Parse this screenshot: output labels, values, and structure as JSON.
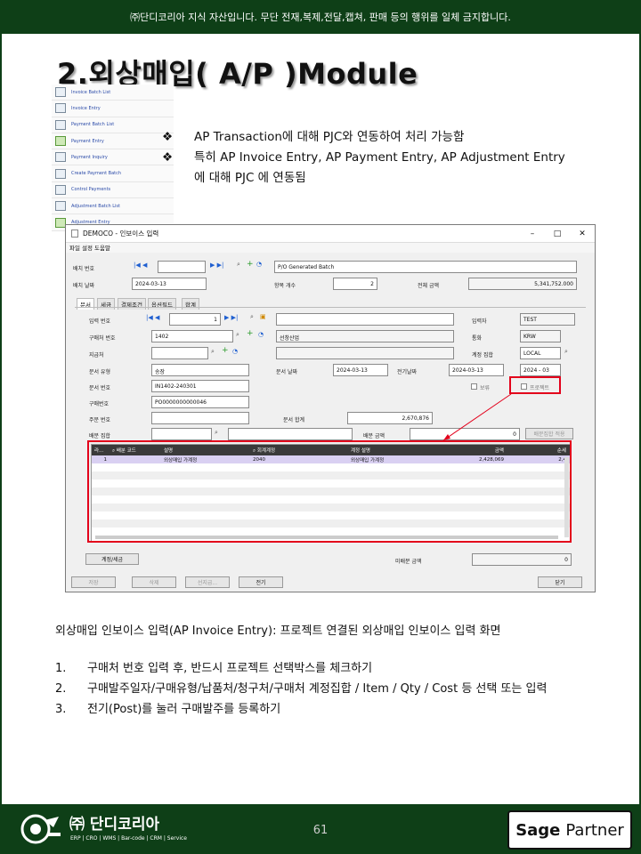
{
  "banner": "㈜단디코리아 지식 자산입니다. 무단 전재,복제,전달,캡쳐, 판매 등의 행위를 일체 금지합니다.",
  "title": "2.외상매입( A/P )Module",
  "side_menu": [
    {
      "label": "Invoice Batch List",
      "icon": "list-icon"
    },
    {
      "label": "Invoice Entry",
      "icon": "document-icon"
    },
    {
      "label": "Payment Batch List",
      "icon": "list-icon"
    },
    {
      "label": "Payment Entry",
      "icon": "payment-icon"
    },
    {
      "label": "Payment Inquiry",
      "icon": "magnifier-icon"
    },
    {
      "label": "Create Payment Batch",
      "icon": "batch-icon"
    },
    {
      "label": "Control Payments",
      "icon": "grid-icon"
    },
    {
      "label": "Adjustment Batch List",
      "icon": "list-icon"
    },
    {
      "label": "Adjustment Entry",
      "icon": "adjust-icon"
    }
  ],
  "bullets": {
    "marker": "❖",
    "line1": "AP Transaction에 대해 PJC와 연동하여 처리 가능함",
    "line2": "특히 AP Invoice Entry,  AP Payment Entry, AP Adjustment Entry",
    "line3": "에 대해 PJC 에 연동됨"
  },
  "window": {
    "title": "DEMOCO - 인보이스 입력",
    "menu": "파일  설정  도움말",
    "batch_no_label": "배치 번호",
    "batch_no": "",
    "batch_desc": "P/O Generated Batch",
    "batch_date_label": "배치 날짜",
    "batch_date": "2024-03-13",
    "entry_count_label": "항목 개수",
    "entry_count": "2",
    "total_label": "전체 금액",
    "total": "5,341,752.000",
    "tabs": [
      "문서",
      "세금",
      "결제조건",
      "옵션필드",
      "합계"
    ],
    "entry_no_label": "입력 번호",
    "entry_no": "1",
    "entered_by_label": "입력자",
    "entered_by": "TEST",
    "vendor_no_label": "구매처 번호",
    "vendor_no": "1402",
    "vendor_name": "선창산업",
    "currency_label": "통화",
    "currency": "KRW",
    "remit_label": "지급처",
    "account_set_label": "계정 집합",
    "account_set": "LOCAL",
    "doc_type_label": "문서 유형",
    "doc_type": "송장",
    "doc_date_label": "문서 날짜",
    "doc_date": "2024-03-13",
    "posting_date_label": "전기날짜",
    "posting_date": "2024-03-13",
    "period": "2024 - 03",
    "doc_no_label": "문서 번호",
    "doc_no": "IN1402-240301",
    "hold_label": "보류",
    "project_label": "프로젝트",
    "po_no_label": "구매번호",
    "po_no": "PO0000000000046",
    "order_no_label": "주문 번호",
    "doc_total_label": "문서 합계",
    "doc_total": "2,670,876",
    "dist_set_label": "배분 집합",
    "dist_amount_label": "배분 금액",
    "dist_amount": "0",
    "dist_apply_btn": "배분집합 적용",
    "grid_headers": [
      "라...",
      "배분 코드",
      "설명",
      "회계계정",
      "계정 설명",
      "금액",
      "순세"
    ],
    "grid_rows": [
      [
        "1",
        "",
        "외상매입 가계정",
        "2040",
        "외상매입 가계정",
        "2,428,069",
        "2,4"
      ]
    ],
    "account_tax_btn": "계정/세금",
    "undist_label": "미배분 금액",
    "undist": "0",
    "save_btn": "저장",
    "delete_btn": "삭제",
    "prepay_btn": "선지급...",
    "post_btn": "전기",
    "close_btn": "닫기"
  },
  "description": "외상매입 인보이스 입력(AP Invoice Entry): 프로젝트 연결된 외상매입 인보이스 입력 화면",
  "steps": [
    {
      "num": "1.",
      "text": "구매처 번호 입력 후, 반드시 프로젝트 선택박스를 체크하기"
    },
    {
      "num": "2.",
      "text": "구매발주일자/구매유형/납품처/청구처/구매처 계정집합  / Item / Qty / Cost  등 선택 또는 입력"
    },
    {
      "num": "3.",
      "text": "전기(Post)를 눌러 구매발주를 등록하기"
    }
  ],
  "footer": {
    "brand": "㈜ 단디코리아",
    "brand_sub": "ERP | CRO | WMS | Bar-code | CRM | Service",
    "page": "61",
    "sage_word": "Sage",
    "partner_word": "Partner"
  }
}
